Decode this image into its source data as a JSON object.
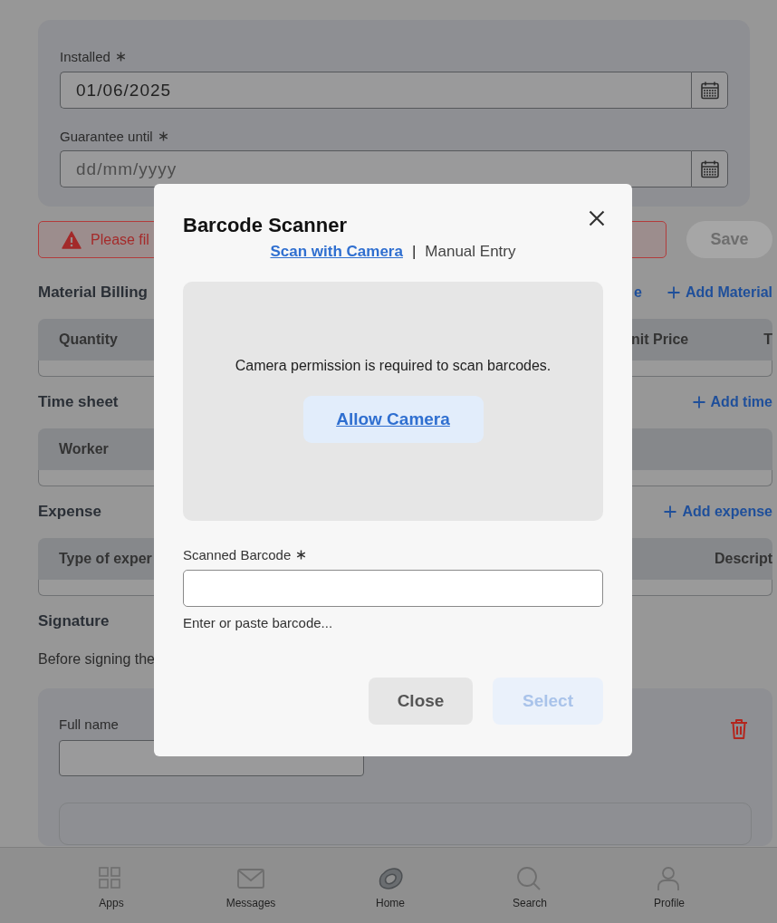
{
  "form_card": {
    "fields": [
      {
        "label": "Installed",
        "required": true,
        "value": "01/06/2025"
      },
      {
        "label": "Guarantee until",
        "required": true,
        "placeholder": "dd/mm/yyyy"
      }
    ]
  },
  "error_banner": {
    "text": "Please fil"
  },
  "save_button": {
    "label": "Save",
    "disabled": true
  },
  "sections": [
    {
      "title": "Material Billing",
      "actions": [
        {
          "kind": "link",
          "label": "e"
        },
        {
          "kind": "add",
          "label": "Add Material"
        }
      ],
      "table": {
        "columns": [
          "Quantity",
          "nit Price",
          "T"
        ]
      }
    },
    {
      "title": "Time sheet",
      "actions": [
        {
          "kind": "add",
          "label": "Add time"
        }
      ],
      "table": {
        "columns": [
          "Worker"
        ]
      }
    },
    {
      "title": "Expense",
      "actions": [
        {
          "kind": "add",
          "label": "Add expense"
        }
      ],
      "table": {
        "columns": [
          "Type of exper",
          "Descript"
        ]
      }
    }
  ],
  "signature": {
    "title": "Signature",
    "description": "Before signing the",
    "name_label": "Full name"
  },
  "bottom_nav": [
    {
      "label": "Apps"
    },
    {
      "label": "Messages"
    },
    {
      "label": "Home"
    },
    {
      "label": "Search"
    },
    {
      "label": "Profile"
    }
  ],
  "modal": {
    "title": "Barcode Scanner",
    "tabs": [
      {
        "label": "Scan with Camera",
        "selected": true
      },
      {
        "label": "Manual Entry",
        "selected": false
      }
    ],
    "separator": "|",
    "camera": {
      "message": "Camera permission is required to scan barcodes.",
      "button": "Allow Camera"
    },
    "barcode_field": {
      "label": "Scanned Barcode",
      "required": true,
      "hint": "Enter or paste barcode..."
    },
    "buttons": [
      {
        "label": "Close",
        "disabled": false
      },
      {
        "label": "Select",
        "disabled": true
      }
    ]
  }
}
